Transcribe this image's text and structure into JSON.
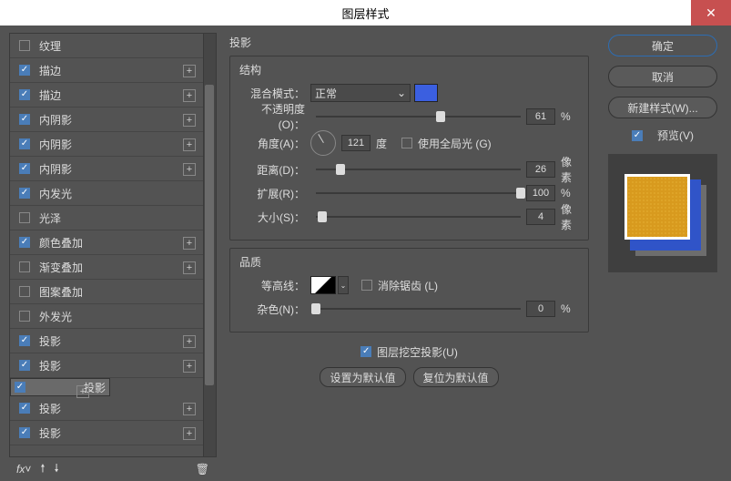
{
  "title": "图层样式",
  "left": {
    "items": [
      {
        "label": "纹理",
        "checked": false,
        "plus": false
      },
      {
        "label": "描边",
        "checked": true,
        "plus": true
      },
      {
        "label": "描边",
        "checked": true,
        "plus": true
      },
      {
        "label": "内阴影",
        "checked": true,
        "plus": true
      },
      {
        "label": "内阴影",
        "checked": true,
        "plus": true
      },
      {
        "label": "内阴影",
        "checked": true,
        "plus": true
      },
      {
        "label": "内发光",
        "checked": true,
        "plus": false
      },
      {
        "label": "光泽",
        "checked": false,
        "plus": false
      },
      {
        "label": "颜色叠加",
        "checked": true,
        "plus": true
      },
      {
        "label": "渐变叠加",
        "checked": false,
        "plus": true
      },
      {
        "label": "图案叠加",
        "checked": false,
        "plus": false
      },
      {
        "label": "外发光",
        "checked": false,
        "plus": false
      },
      {
        "label": "投影",
        "checked": true,
        "plus": true
      },
      {
        "label": "投影",
        "checked": true,
        "plus": true
      },
      {
        "label": "投影",
        "checked": true,
        "plus": true,
        "selected": true
      },
      {
        "label": "投影",
        "checked": true,
        "plus": true
      },
      {
        "label": "投影",
        "checked": true,
        "plus": true
      }
    ]
  },
  "mid": {
    "panel_title": "投影",
    "section_structure": "结构",
    "section_quality": "品质",
    "blend_label": "混合模式：",
    "blend_value": "正常",
    "opacity_label": "不透明度(O)：",
    "opacity_value": "61",
    "opacity_unit": "%",
    "angle_label": "角度(A)：",
    "angle_value": "121",
    "angle_unit": "度",
    "global_label": "使用全局光 (G)",
    "distance_label": "距离(D)：",
    "distance_value": "26",
    "distance_unit": "像素",
    "spread_label": "扩展(R)：",
    "spread_value": "100",
    "spread_unit": "%",
    "size_label": "大小(S)：",
    "size_value": "4",
    "size_unit": "像素",
    "contour_label": "等高线：",
    "aa_label": "消除锯齿 (L)",
    "noise_label": "杂色(N)：",
    "noise_value": "0",
    "noise_unit": "%",
    "knockout_label": "图层挖空投影(U)",
    "btn_default": "设置为默认值",
    "btn_reset": "复位为默认值"
  },
  "right": {
    "ok": "确定",
    "cancel": "取消",
    "new_style": "新建样式(W)...",
    "preview": "预览(V)"
  }
}
